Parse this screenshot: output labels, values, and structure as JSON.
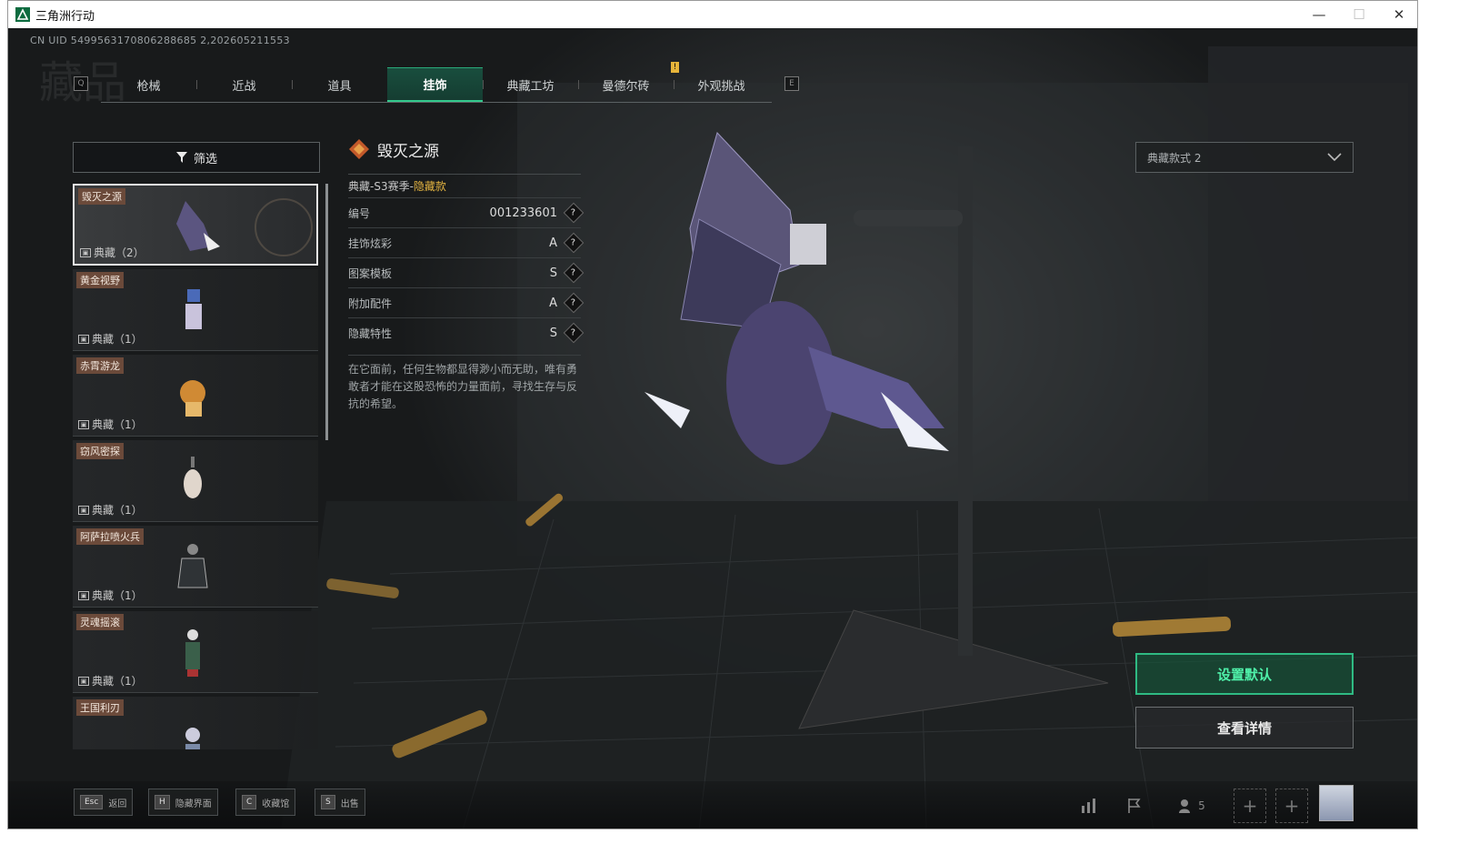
{
  "window": {
    "title": "三角洲行动",
    "minimize": "—",
    "maximize": "☐",
    "close": "✕"
  },
  "header": {
    "uid": "CN UID 5499563170806288685 2,202605211553",
    "bg_title": "藏品"
  },
  "tabs": {
    "left_key": "Q",
    "right_key": "E",
    "items": [
      {
        "label": "枪械"
      },
      {
        "label": "近战"
      },
      {
        "label": "道具"
      },
      {
        "label": "挂饰"
      },
      {
        "label": "典藏工坊"
      },
      {
        "label": "曼德尔砖"
      },
      {
        "label": "外观挑战"
      }
    ],
    "active_index": 3,
    "notice_mark": "!"
  },
  "filter": {
    "label": "筛选"
  },
  "items": [
    {
      "name": "毁灭之源",
      "tier": "典藏（2）",
      "selected": true
    },
    {
      "name": "黄金视野",
      "tier": "典藏（1）"
    },
    {
      "name": "赤霄游龙",
      "tier": "典藏（1）"
    },
    {
      "name": "窃风密探",
      "tier": "典藏（1）"
    },
    {
      "name": "阿萨拉喷火兵",
      "tier": "典藏（1）"
    },
    {
      "name": "灵魂摇滚",
      "tier": "典藏（1）"
    },
    {
      "name": "王国利刃",
      "tier": ""
    }
  ],
  "detail": {
    "name": "毁灭之源",
    "subtitle_prefix": "典藏-S3赛季-",
    "subtitle_highlight": "隐藏款",
    "props": [
      {
        "label": "编号",
        "value": "001233601"
      },
      {
        "label": "挂饰炫彩",
        "value": "A"
      },
      {
        "label": "图案模板",
        "value": "S"
      },
      {
        "label": "附加配件",
        "value": "A"
      },
      {
        "label": "隐藏特性",
        "value": "S"
      }
    ],
    "help": "?",
    "description": "在它面前，任何生物都显得渺小而无助，唯有勇敢者才能在这股恐怖的力量面前，寻找生存与反抗的希望。"
  },
  "variant": {
    "selected": "典藏款式 2"
  },
  "actions": {
    "set_default": "设置默认",
    "view_detail": "查看详情"
  },
  "bottom": {
    "keys": [
      {
        "key": "Esc",
        "label": "返回"
      },
      {
        "key": "H",
        "label": "隐藏界面"
      },
      {
        "key": "C",
        "label": "收藏馆"
      },
      {
        "key": "S",
        "label": "出售"
      }
    ],
    "friends_count": "5",
    "plus": "+"
  },
  "colors": {
    "accent": "#32c98c",
    "gold": "#e2b341",
    "name_tag": "#6b4a3a"
  }
}
